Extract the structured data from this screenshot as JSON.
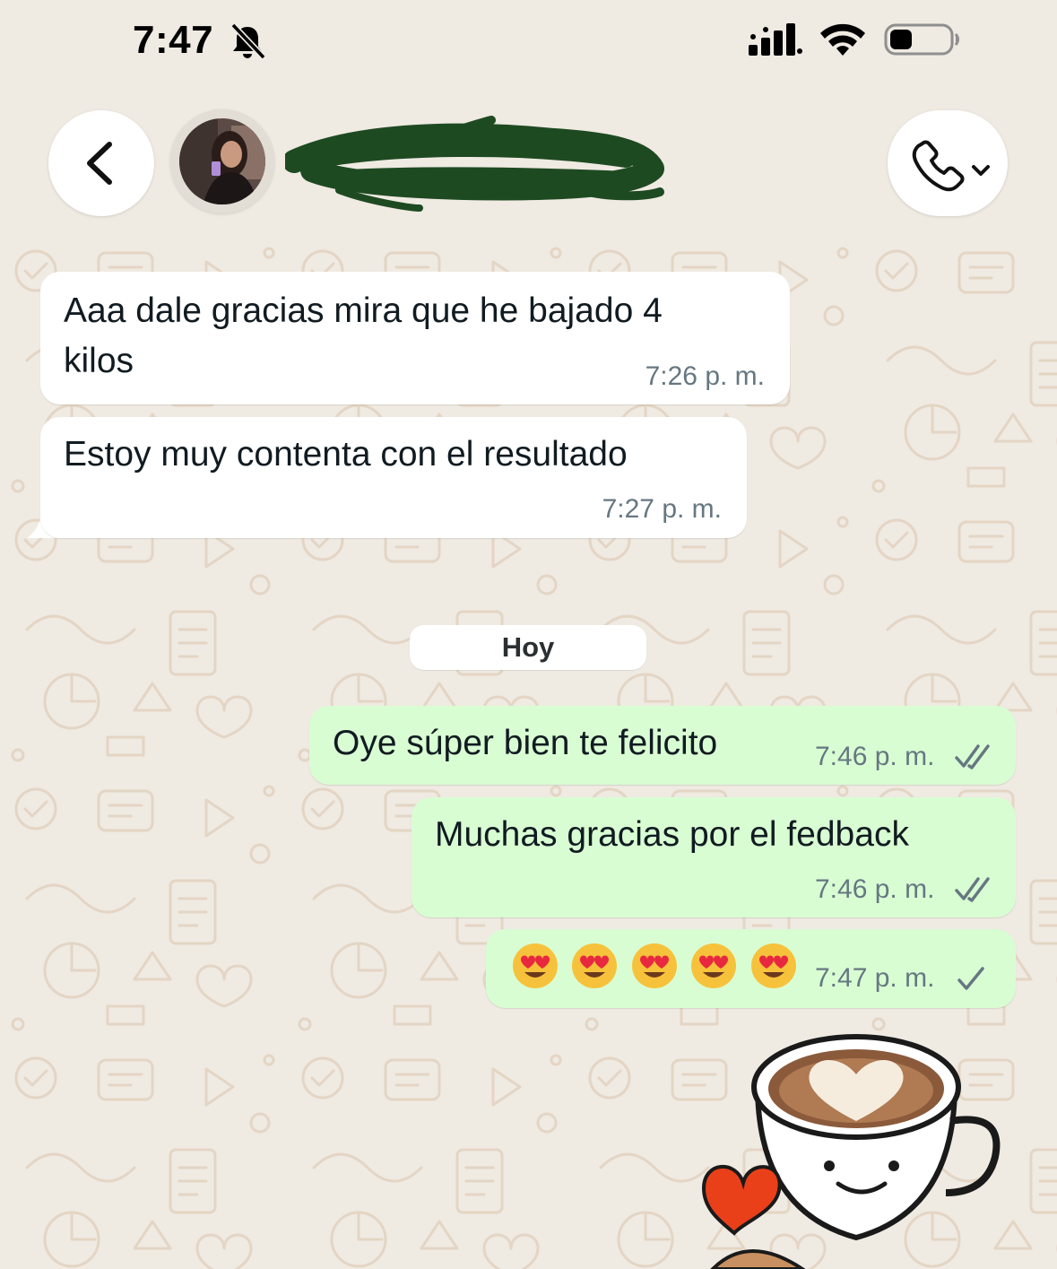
{
  "status_bar": {
    "time": "7:47",
    "icons": [
      "bell-slash-icon",
      "cellular-signal-icon",
      "wifi-icon",
      "battery-icon"
    ]
  },
  "header": {
    "back_icon": "chevron-left-icon",
    "contact_name": "",
    "call_icon": "phone-icon",
    "call_menu_icon": "chevron-down-icon"
  },
  "day_separator": "Hoy",
  "messages": [
    {
      "direction": "in",
      "lines": [
        "Aaa dale gracias mira que he bajado 4",
        "kilos"
      ],
      "time": "7:26 p. m."
    },
    {
      "direction": "in",
      "lines": [
        "Estoy muy contenta con el resultado"
      ],
      "time": "7:27 p. m."
    },
    {
      "direction": "out",
      "lines": [
        "Oye súper bien te felicito"
      ],
      "time": "7:46 p. m.",
      "status": "read-double-check"
    },
    {
      "direction": "out",
      "lines": [
        "Muchas gracias por el fedback"
      ],
      "time": "7:46 p. m.",
      "status": "read-double-check"
    },
    {
      "direction": "out",
      "emoji": [
        "😍",
        "😍",
        "😍",
        "😍",
        "😍"
      ],
      "time": "7:47 p. m.",
      "status": "sent-single-check"
    }
  ],
  "sticker": "coffee-cup-heart-sticker",
  "colors": {
    "background": "#efeae2",
    "incoming_bubble": "#ffffff",
    "outgoing_bubble": "#d9fdd3",
    "timestamp": "#667781",
    "redaction": "#1e4a22"
  }
}
